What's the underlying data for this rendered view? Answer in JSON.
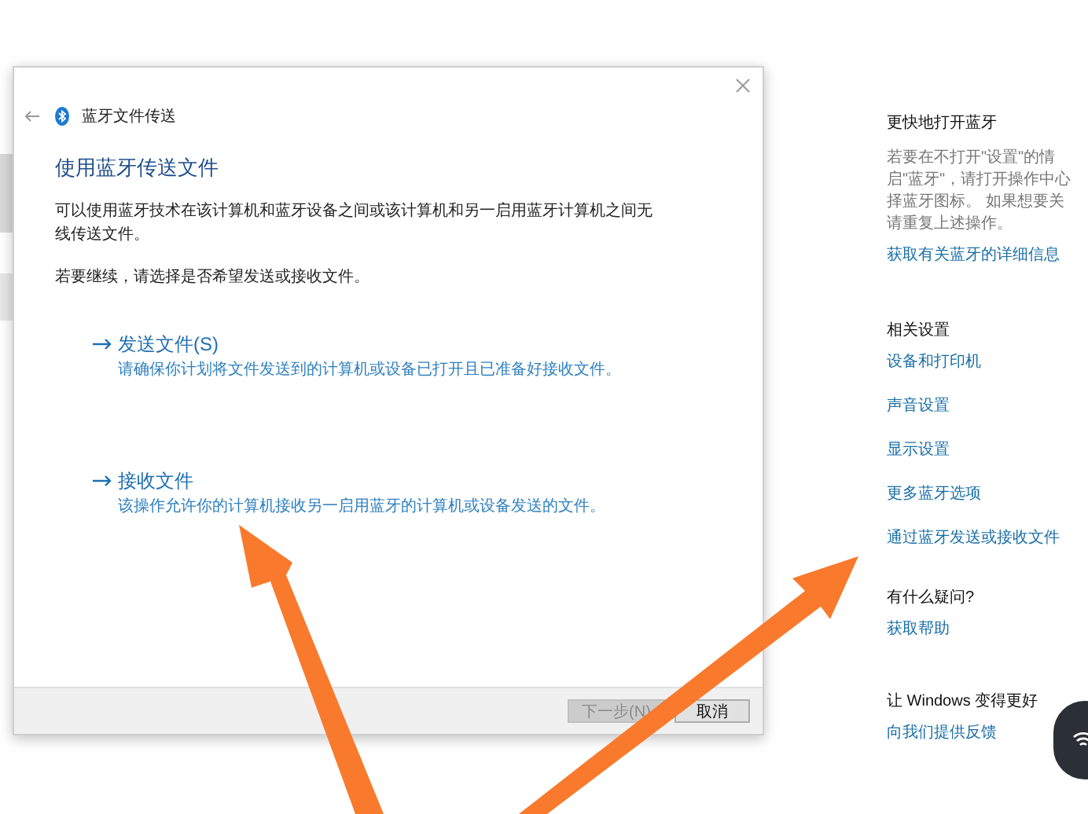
{
  "dialog": {
    "title": "蓝牙文件传送",
    "heading": "使用蓝牙传送文件",
    "description": "可以使用蓝牙技术在该计算机和蓝牙设备之间或该计算机和另一启用蓝牙计算机之间无线传送文件。",
    "prompt": "若要继续，请选择是否希望发送或接收文件。",
    "options": [
      {
        "label": "发送文件(S)",
        "hint": "请确保你计划将文件发送到的计算机或设备已打开且已准备好接收文件。"
      },
      {
        "label": "接收文件",
        "hint": "该操作允许你的计算机接收另一启用蓝牙的计算机或设备发送的文件。"
      }
    ],
    "buttons": [
      {
        "label": "下一步(N)",
        "disabled": true
      },
      {
        "label": "取消",
        "disabled": false
      }
    ]
  },
  "side_panel": {
    "sections": [
      {
        "heading": "更快地打开蓝牙",
        "lines": [
          "若要在不打开\"设置\"的情",
          "启\"蓝牙\"，请打开操作中心",
          "择蓝牙图标。 如果想要关",
          "请重复上述操作。"
        ],
        "links": [
          "获取有关蓝牙的详细信息"
        ]
      },
      {
        "heading": "相关设置",
        "links": [
          "设备和打印机",
          "声音设置",
          "显示设置",
          "更多蓝牙选项",
          "通过蓝牙发送或接收文件"
        ]
      },
      {
        "heading": "有什么疑问?",
        "links": [
          "获取帮助"
        ]
      },
      {
        "heading": "让 Windows 变得更好",
        "links": [
          "向我们提供反馈"
        ]
      }
    ]
  }
}
